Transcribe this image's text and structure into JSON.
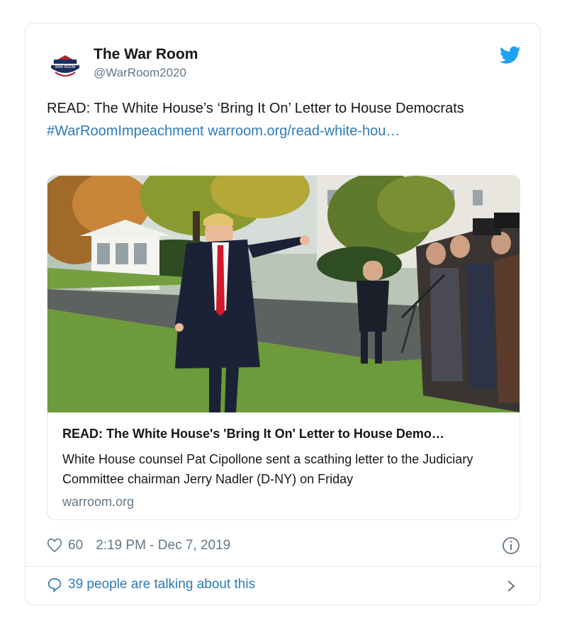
{
  "account": {
    "name": "The War Room",
    "handle": "@WarRoom2020",
    "avatar_icon": "war-room-logo",
    "avatar_logo_text": "WAR ROOM"
  },
  "tweet": {
    "text": "READ: The White House’s ‘Bring It On’ Letter to House Democrats ",
    "hashtag": "#WarRoomImpeachment",
    "link": "warroom.org/read-white-hou…"
  },
  "link_card": {
    "title": "READ: The White House's 'Bring It On' Letter to House Demo…",
    "description": "White House counsel Pat Cipollone sent a scathing letter to the Judiciary Committee chairman Jerry Nadler (D-NY) on Friday",
    "domain": "warroom.org"
  },
  "meta": {
    "likes": "60",
    "timestamp": "2:19 PM - Dec 7, 2019"
  },
  "footer": {
    "talking": "39 people are talking about this"
  },
  "colors": {
    "link": "#2b7bb9",
    "muted": "#657786",
    "twitter_blue": "#1da1f2",
    "border": "#e1e8ed"
  }
}
